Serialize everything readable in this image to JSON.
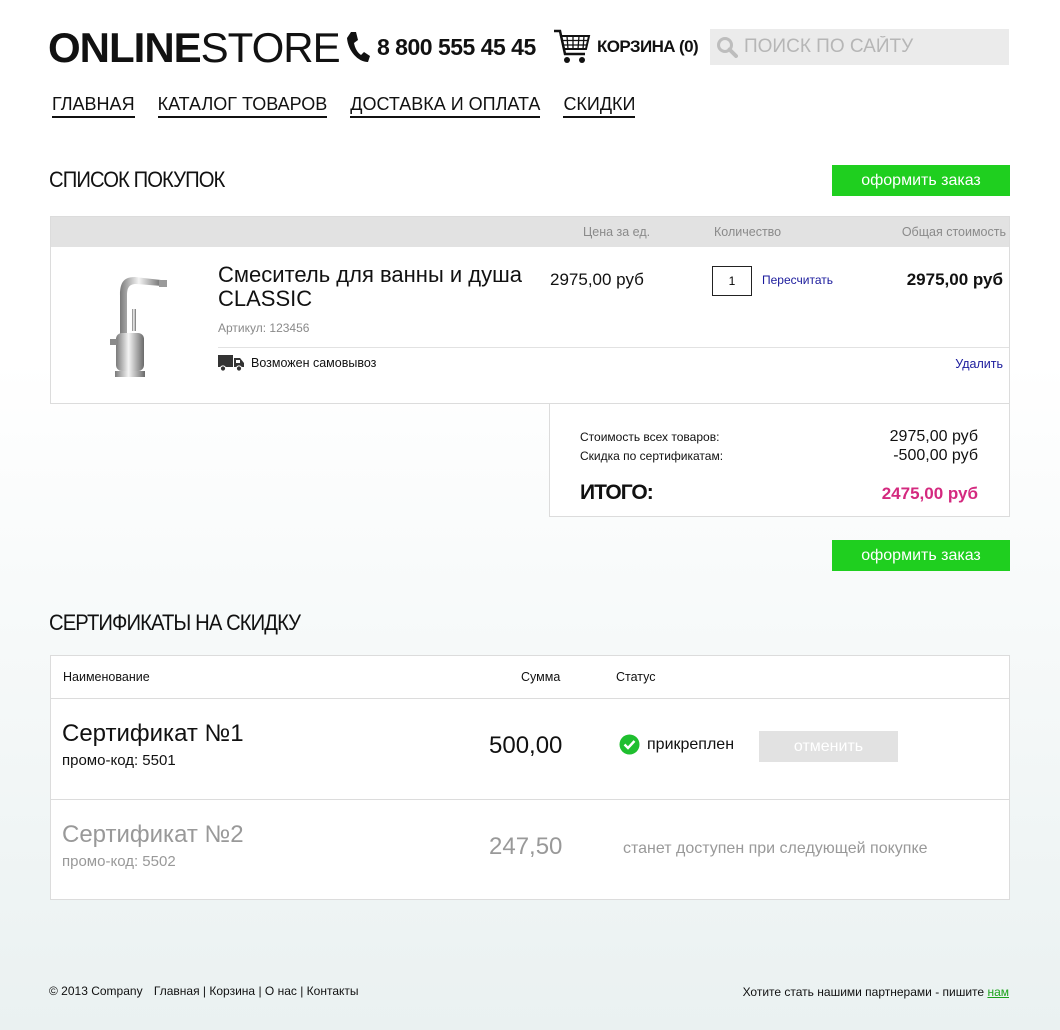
{
  "header": {
    "logo_bold": "ONLINE",
    "logo_light": "STORE",
    "phone": "8 800 555 45 45",
    "cart_label": "КОРЗИНА (0)",
    "search_placeholder": "ПОИСК ПО САЙТУ"
  },
  "nav": {
    "items": [
      "ГЛАВНАЯ",
      "КАТАЛОГ ТОВАРОВ",
      "ДОСТАВКА И ОПЛАТА",
      "СКИДКИ"
    ]
  },
  "cart": {
    "title": "СПИСОК ПОКУПОК",
    "order_button": "оформить заказ",
    "columns": {
      "price": "Цена за ед.",
      "qty": "Количество",
      "total": "Общая стоимость"
    },
    "item": {
      "name": "Смеситель для ванны и душа CLASSIC",
      "article": "Артикул: 123456",
      "price": "2975,00 руб",
      "qty": "1",
      "recalc": "Пересчитать",
      "total": "2975,00 руб",
      "pickup": "Возможен самовывоз",
      "delete": "Удалить"
    },
    "summary": {
      "goods_label": "Стоимость всех товаров:",
      "goods_value": "2975,00 руб",
      "discount_label": "Скидка по сертификатам:",
      "discount_value": "-500,00 руб",
      "total_label": "ИТОГО:",
      "total_value": "2475,00 руб"
    }
  },
  "certificates": {
    "title": "СЕРТИФИКАТЫ НА СКИДКУ",
    "columns": {
      "name": "Наименование",
      "sum": "Сумма",
      "status": "Статус"
    },
    "rows": [
      {
        "name": "Сертификат №1",
        "code": "промо-код: 5501",
        "sum": "500,00",
        "status": "прикреплен",
        "action": "отменить"
      },
      {
        "name": "Сертификат №2",
        "code": "промо-код: 5502",
        "sum": "247,50",
        "status": "станет доступен при следующей покупке"
      }
    ]
  },
  "footer": {
    "copyright": "© 2013 Company",
    "links": [
      "Главная",
      "Корзина",
      "О нас",
      "Контакты"
    ],
    "partner_text": "Хотите стать нашими партнерами - пишите",
    "partner_link": "нам"
  },
  "colors": {
    "accent_green": "#1fcf1f",
    "total_pink": "#d4297f",
    "check_green": "#1fbf2f"
  }
}
